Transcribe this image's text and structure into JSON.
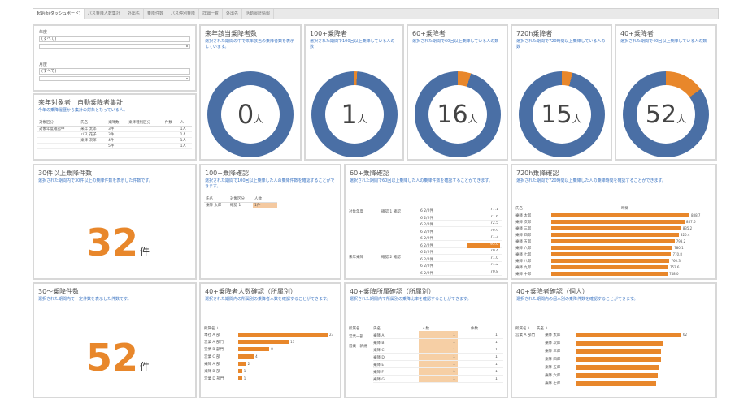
{
  "colors": {
    "accent_orange": "#e8872b",
    "donut_blue": "#4a6fa5",
    "desc_blue": "#3b74c2",
    "panel_border": "#d8d8d8"
  },
  "tabs": [
    "起始页(ダッシュボード)",
    "バス乗降人数集計",
    "外出先",
    "乗降件数",
    "バス停別乗降",
    "詳細一覧",
    "外出先",
    "活動履歴情報"
  ],
  "filters": [
    {
      "label": "年度",
      "value": "(すべて)"
    },
    {
      "label": "月度",
      "value": "(すべて)"
    }
  ],
  "persons_panel": {
    "title": "来年対象者　自動乗降者集計",
    "desc": "今年の乗降履歴から集計の対象となっている人。",
    "headers": [
      "対象区分",
      "氏名",
      "乗降数",
      "乗降種別区分",
      "件数",
      "人"
    ],
    "rows": [
      [
        "対象年度確認中",
        "来年 太郎",
        "3件",
        "",
        "",
        "1人"
      ],
      [
        "",
        "バス 花子",
        "3件",
        "",
        "",
        "1人"
      ],
      [
        "",
        "乗降 次郎",
        "4件",
        "",
        "",
        "1人"
      ],
      [
        "",
        "",
        "5件",
        "",
        "",
        "1人"
      ]
    ]
  },
  "donuts": [
    {
      "title": "来年該当乗降者数",
      "desc": "選択された期間の中で来年該当の乗降者数を表示しています。",
      "value": "0",
      "unit": "人",
      "fraction": 0.0
    },
    {
      "title": "100+乗降者",
      "desc": "選択された期間で100回以上乗降している人の数",
      "value": "1",
      "unit": "人",
      "fraction": 0.01
    },
    {
      "title": "60+乗降者",
      "desc": "選択された期間で60回以上乗降している人の数",
      "value": "16",
      "unit": "人",
      "fraction": 0.05
    },
    {
      "title": "720h乗降者",
      "desc": "選択された期間で720時間以上乗降している人の数",
      "value": "15",
      "unit": "人",
      "fraction": 0.04
    },
    {
      "title": "40+乗降者",
      "desc": "選択された期間で40回以上乗降している人の数",
      "value": "52",
      "unit": "人",
      "fraction": 0.15
    }
  ],
  "kpi_32": {
    "title": "30件以上乗降件数",
    "desc": "選択された期間内で30件以上の乗降件数を表示した件数です。",
    "value": "32",
    "unit": "件"
  },
  "kpi_52": {
    "title": "30〜乗降件数",
    "desc": "選択された期間内で一定件数を表示した件数です。",
    "value": "52",
    "unit": "件"
  },
  "panel_100": {
    "title": "100+乗降確認",
    "desc": "選択された期間で100回以上乗降した人の乗降件数を確認することができます。",
    "headers": [
      "氏名",
      "対象区分",
      "人数"
    ],
    "rows": [
      [
        "乗降 太郎",
        "確認 1",
        "1件"
      ]
    ]
  },
  "panel_60": {
    "title": "60+乗降確認",
    "desc": "選択された期間で60回以上乗降した人の乗降件数を確認することができます。",
    "group_labels": [
      "対象年度",
      "来年乗降"
    ],
    "sub_labels": [
      "確認 1 確認",
      "確認 2 確認"
    ],
    "rows": [
      "6 2/2件",
      "6 2/2件",
      "6 2/2件",
      "6 2/2件",
      "6 2/2件",
      "6 2/2件",
      "6 2/2件",
      "6 2/2件",
      "6 2/2件",
      "6 2/2件"
    ],
    "values": [
      "77.1",
      "71.6",
      "72.5",
      "70.9",
      "71.3",
      "95.0",
      "70.4",
      "71.0",
      "71.2",
      "70.8"
    ],
    "highlight_index": 5
  },
  "panel_720": {
    "title": "720h乗降確認",
    "desc": "選択された期間で720時間以上乗降した人の乗降時間を確認することができます。",
    "headers": [
      "氏名",
      "時間"
    ],
    "names": [
      "乗降 太郎",
      "乗降 次郎",
      "乗降 三郎",
      "乗降 四郎",
      "乗降 五郎",
      "乗降 六郎",
      "乗降 七郎",
      "乗降 八郎",
      "乗降 九郎",
      "乗降 十郎"
    ],
    "values": [
      888.7,
      857.6,
      835.2,
      820.4,
      793.2,
      780.1,
      770.8,
      760.3,
      752.6,
      748.0
    ],
    "labels": [
      "888.7",
      "857.6",
      "835.2",
      "820.4",
      "793.2",
      "780.1",
      "770.8",
      "760.3",
      "752.6",
      "748.0"
    ]
  },
  "panel_40_person": {
    "title": "40+乗降者人数確認（所属別）",
    "desc": "選択された期間内の所属別の乗降者人数を確認することができます。",
    "header": "所属名 ↓",
    "names": [
      "本社 A 部",
      "営業 A 部門",
      "営業 B 部門",
      "営業 C 部",
      "乗降 A 部",
      "乗降 B 部",
      "営業 D 部門"
    ],
    "values": [
      23,
      13,
      8,
      4,
      2,
      1,
      1
    ],
    "labels": [
      "23",
      "13",
      "8",
      "4",
      "2",
      "1",
      "1"
    ]
  },
  "panel_40_ratio": {
    "title": "40+乗降所属確認（所属別）",
    "desc": "選択された期間内で所属別の乗降比率を確認することができます。",
    "headers": [
      "所属名",
      "氏名",
      "人数",
      "件数"
    ],
    "groups": [
      "営業一部",
      "営業・新規"
    ],
    "names": [
      "乗降 A",
      "乗降 B",
      "乗降 C",
      "乗降 D",
      "乗降 E",
      "乗降 F",
      "乗降 G"
    ],
    "counts": [
      "1",
      "1",
      "1",
      "1",
      "1",
      "1",
      "1"
    ]
  },
  "panel_40_detail": {
    "title": "40+乗降者確認（個人）",
    "desc": "選択された期間内の個人別の乗降件数を確認することができます。",
    "headers": [
      "所属名 ↓",
      "氏名 ↓"
    ],
    "group": "営業 A 部門",
    "names": [
      "乗降 太郎",
      "乗降 次郎",
      "乗降 三郎",
      "乗降 四郎",
      "乗降 五郎",
      "乗降 六郎",
      "乗降 七郎"
    ],
    "values": [
      62,
      51,
      50,
      50,
      49,
      48,
      47
    ],
    "labels": [
      "62",
      "",
      "",
      "",
      "",
      "",
      ""
    ]
  }
}
